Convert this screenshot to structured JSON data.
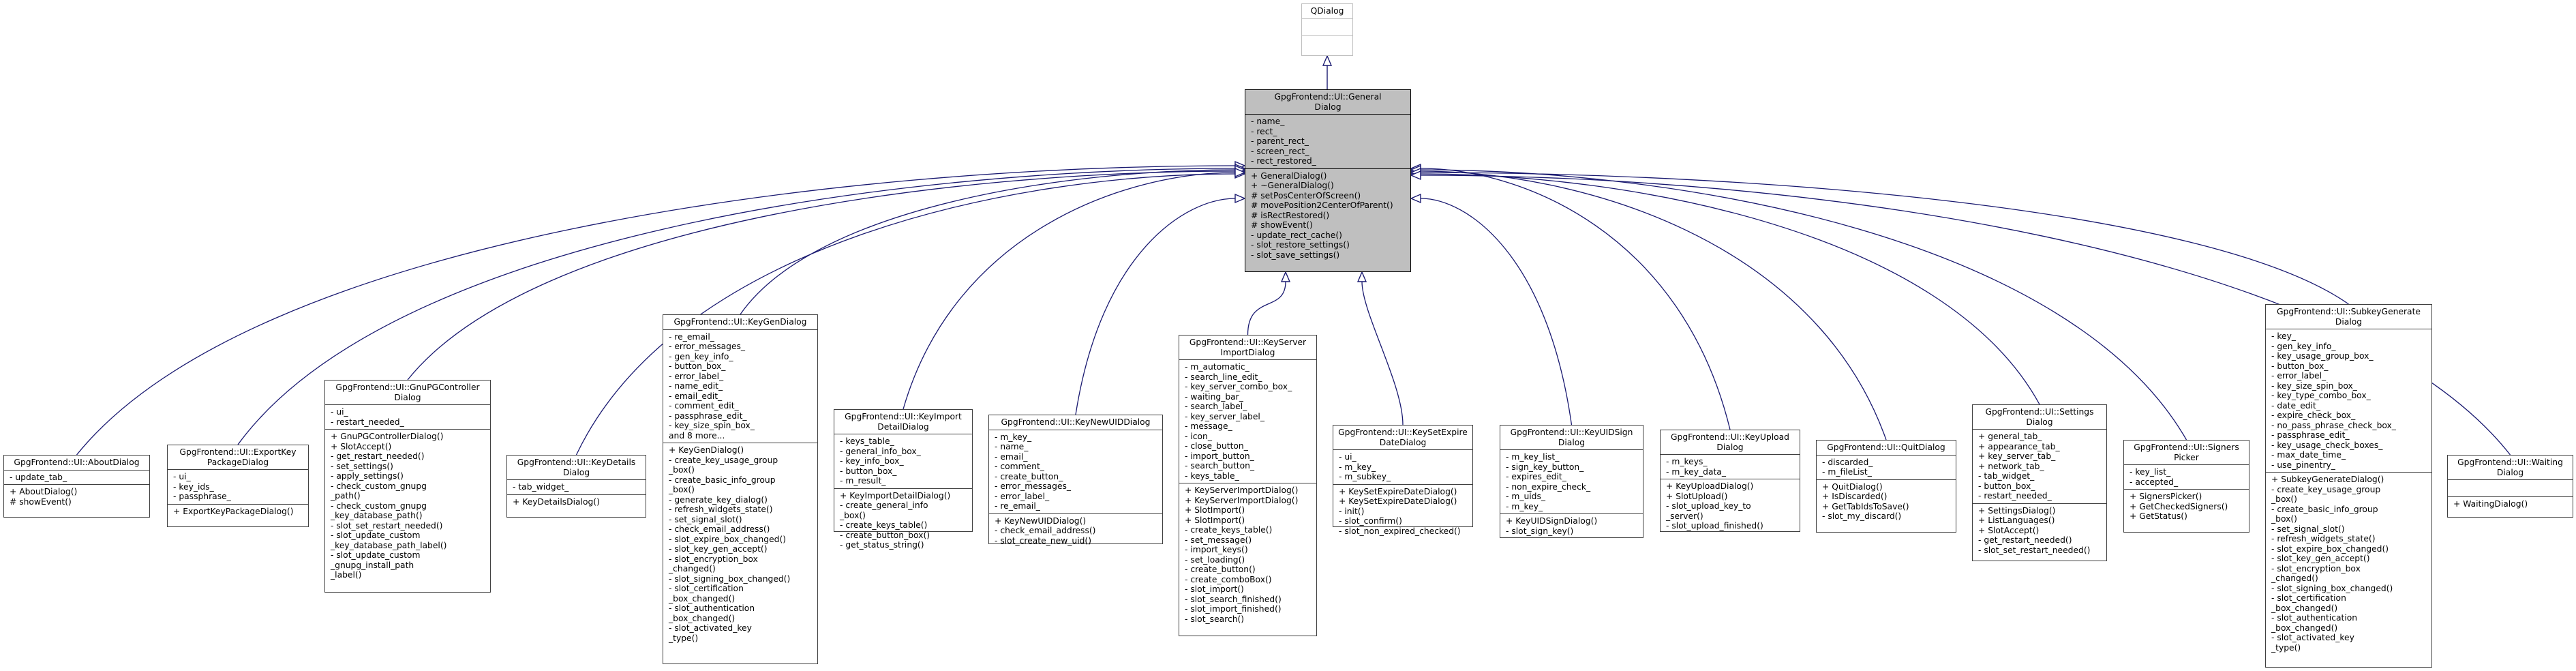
{
  "diagram": {
    "type": "uml-class-inheritance",
    "edge_color": "#191970",
    "root": {
      "id": "qdialog",
      "title": "QDialog",
      "attributes": [],
      "operations": []
    },
    "base": {
      "id": "general-dialog",
      "title": "GpgFrontend::UI::General\nDialog",
      "attributes": [
        "- name_",
        "- rect_",
        "- parent_rect_",
        "- screen_rect_",
        "- rect_restored_"
      ],
      "operations": [
        "+ GeneralDialog()",
        "+ ~GeneralDialog()",
        "# setPosCenterOfScreen()",
        "# movePosition2CenterOfParent()",
        "# isRectRestored()",
        "# showEvent()",
        "- update_rect_cache()",
        "- slot_restore_settings()",
        "- slot_save_settings()"
      ]
    },
    "children": [
      {
        "id": "about-dialog",
        "title": "GpgFrontend::UI::AboutDialog",
        "attributes": [
          "- update_tab_"
        ],
        "operations": [
          "+ AboutDialog()",
          "# showEvent()"
        ]
      },
      {
        "id": "export-key-package-dialog",
        "title": "GpgFrontend::UI::ExportKey\nPackageDialog",
        "attributes": [
          "- ui_",
          "- key_ids_",
          "- passphrase_"
        ],
        "operations": [
          "+ ExportKeyPackageDialog()"
        ]
      },
      {
        "id": "gnupg-controller-dialog",
        "title": "GpgFrontend::UI::GnuPGController\nDialog",
        "attributes": [
          "- ui_",
          "- restart_needed_"
        ],
        "operations": [
          "+ GnuPGControllerDialog()",
          "+ SlotAccept()",
          "- get_restart_needed()",
          "- set_settings()",
          "- apply_settings()",
          "- check_custom_gnupg",
          "_path()",
          "- check_custom_gnupg",
          "_key_database_path()",
          "- slot_set_restart_needed()",
          "- slot_update_custom",
          "_key_database_path_label()",
          "- slot_update_custom",
          "_gnupg_install_path",
          "_label()"
        ]
      },
      {
        "id": "key-details-dialog",
        "title": "GpgFrontend::UI::KeyDetails\nDialog",
        "attributes": [
          "- tab_widget_"
        ],
        "operations": [
          "+ KeyDetailsDialog()"
        ]
      },
      {
        "id": "key-gen-dialog",
        "title": "GpgFrontend::UI::KeyGenDialog",
        "attributes": [
          "- re_email_",
          "- error_messages_",
          "- gen_key_info_",
          "- button_box_",
          "- error_label_",
          "- name_edit_",
          "- email_edit_",
          "- comment_edit_",
          "- passphrase_edit_",
          "- key_size_spin_box_",
          "and 8 more..."
        ],
        "operations": [
          "+ KeyGenDialog()",
          "- create_key_usage_group",
          "_box()",
          "- create_basic_info_group",
          "_box()",
          "- generate_key_dialog()",
          "- refresh_widgets_state()",
          "- set_signal_slot()",
          "- check_email_address()",
          "- slot_expire_box_changed()",
          "- slot_key_gen_accept()",
          "- slot_encryption_box",
          "_changed()",
          "- slot_signing_box_changed()",
          "- slot_certification",
          "_box_changed()",
          "- slot_authentication",
          "_box_changed()",
          "- slot_activated_key",
          "_type()"
        ]
      },
      {
        "id": "key-import-detail-dialog",
        "title": "GpgFrontend::UI::KeyImport\nDetailDialog",
        "attributes": [
          "- keys_table_",
          "- general_info_box_",
          "- key_info_box_",
          "- button_box_",
          "- m_result_"
        ],
        "operations": [
          "+ KeyImportDetailDialog()",
          "- create_general_info",
          "_box()",
          "- create_keys_table()",
          "- create_button_box()",
          "- get_status_string()"
        ]
      },
      {
        "id": "key-new-uid-dialog",
        "title": "GpgFrontend::UI::KeyNewUIDDialog",
        "attributes": [
          "- m_key_",
          "- name_",
          "- email_",
          "- comment_",
          "- create_button_",
          "- error_messages_",
          "- error_label_",
          "- re_email_"
        ],
        "operations": [
          "+ KeyNewUIDDialog()",
          "- check_email_address()",
          "- slot_create_new_uid()"
        ]
      },
      {
        "id": "key-server-import-dialog",
        "title": "GpgFrontend::UI::KeyServer\nImportDialog",
        "attributes": [
          "- m_automatic_",
          "- search_line_edit_",
          "- key_server_combo_box_",
          "- waiting_bar_",
          "- search_label_",
          "- key_server_label_",
          "- message_",
          "- icon_",
          "- close_button_",
          "- import_button_",
          "- search_button_",
          "- keys_table_"
        ],
        "operations": [
          "+ KeyServerImportDialog()",
          "+ KeyServerImportDialog()",
          "+ SlotImport()",
          "+ SlotImport()",
          "- create_keys_table()",
          "- set_message()",
          "- import_keys()",
          "- set_loading()",
          "- create_button()",
          "- create_comboBox()",
          "- slot_import()",
          "- slot_search_finished()",
          "- slot_import_finished()",
          "- slot_search()"
        ]
      },
      {
        "id": "key-set-expire-date-dialog",
        "title": "GpgFrontend::UI::KeySetExpire\nDateDialog",
        "attributes": [
          "- ui_",
          "- m_key_",
          "- m_subkey_"
        ],
        "operations": [
          "+ KeySetExpireDateDialog()",
          "+ KeySetExpireDateDialog()",
          "- init()",
          "- slot_confirm()",
          "- slot_non_expired_checked()"
        ]
      },
      {
        "id": "key-uid-sign-dialog",
        "title": "GpgFrontend::UI::KeyUIDSign\nDialog",
        "attributes": [
          "- m_key_list_",
          "- sign_key_button_",
          "- expires_edit_",
          "- non_expire_check_",
          "- m_uids_",
          "- m_key_"
        ],
        "operations": [
          "+ KeyUIDSignDialog()",
          "- slot_sign_key()"
        ]
      },
      {
        "id": "key-upload-dialog",
        "title": "GpgFrontend::UI::KeyUpload\nDialog",
        "attributes": [
          "- m_keys_",
          "- m_key_data_"
        ],
        "operations": [
          "+ KeyUploadDialog()",
          "+ SlotUpload()",
          "- slot_upload_key_to",
          "_server()",
          "- slot_upload_finished()"
        ]
      },
      {
        "id": "quit-dialog",
        "title": "GpgFrontend::UI::QuitDialog",
        "attributes": [
          "- discarded_",
          "- m_fileList_"
        ],
        "operations": [
          "+ QuitDialog()",
          "+ IsDiscarded()",
          "+ GetTabIdsToSave()",
          "- slot_my_discard()"
        ]
      },
      {
        "id": "settings-dialog",
        "title": "GpgFrontend::UI::Settings\nDialog",
        "attributes": [
          "+ general_tab_",
          "+ appearance_tab_",
          "+ key_server_tab_",
          "+ network_tab_",
          "- tab_widget_",
          "- button_box_",
          "- restart_needed_"
        ],
        "operations": [
          "+ SettingsDialog()",
          "+ ListLanguages()",
          "+ SlotAccept()",
          "- get_restart_needed()",
          "- slot_set_restart_needed()"
        ]
      },
      {
        "id": "signers-picker",
        "title": "GpgFrontend::UI::Signers\nPicker",
        "attributes": [
          "- key_list_",
          "- accepted_"
        ],
        "operations": [
          "+ SignersPicker()",
          "+ GetCheckedSigners()",
          "+ GetStatus()"
        ]
      },
      {
        "id": "subkey-generate-dialog",
        "title": "GpgFrontend::UI::SubkeyGenerate\nDialog",
        "attributes": [
          "- key_",
          "- gen_key_info_",
          "- key_usage_group_box_",
          "- button_box_",
          "- error_label_",
          "- key_size_spin_box_",
          "- key_type_combo_box_",
          "- date_edit_",
          "- expire_check_box_",
          "- no_pass_phrase_check_box_",
          "- passphrase_edit_",
          "- key_usage_check_boxes_",
          "- max_date_time_",
          "- use_pinentry_"
        ],
        "operations": [
          "+ SubkeyGenerateDialog()",
          "- create_key_usage_group",
          "_box()",
          "- create_basic_info_group",
          "_box()",
          "- set_signal_slot()",
          "- refresh_widgets_state()",
          "- slot_expire_box_changed()",
          "- slot_key_gen_accept()",
          "- slot_encryption_box",
          "_changed()",
          "- slot_signing_box_changed()",
          "- slot_certification",
          "_box_changed()",
          "- slot_authentication",
          "_box_changed()",
          "- slot_activated_key",
          "_type()"
        ]
      },
      {
        "id": "waiting-dialog",
        "title": "GpgFrontend::UI::Waiting\nDialog",
        "attributes": [],
        "operations": [
          "+ WaitingDialog()"
        ]
      }
    ]
  }
}
